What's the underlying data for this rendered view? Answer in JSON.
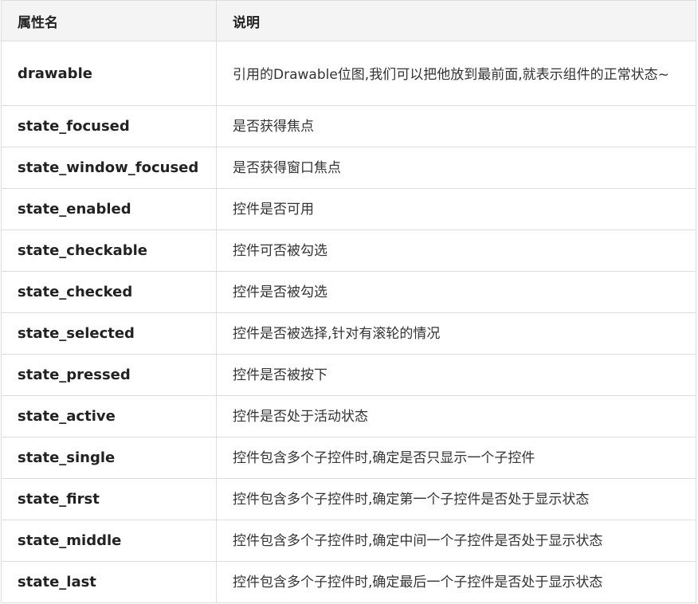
{
  "header": {
    "name": "属性名",
    "description": "说明"
  },
  "rows": [
    {
      "name": "drawable",
      "description": "引用的Drawable位图,我们可以把他放到最前面,就表示组件的正常状态~"
    },
    {
      "name": "state_focused",
      "description": "是否获得焦点"
    },
    {
      "name": "state_window_focused",
      "description": "是否获得窗口焦点"
    },
    {
      "name": "state_enabled",
      "description": "控件是否可用"
    },
    {
      "name": "state_checkable",
      "description": "控件可否被勾选"
    },
    {
      "name": "state_checked",
      "description": "控件是否被勾选"
    },
    {
      "name": "state_selected",
      "description": "控件是否被选择,针对有滚轮的情况"
    },
    {
      "name": "state_pressed",
      "description": "控件是否被按下"
    },
    {
      "name": "state_active",
      "description": "控件是否处于活动状态"
    },
    {
      "name": "state_single",
      "description": "控件包含多个子控件时,确定是否只显示一个子控件"
    },
    {
      "name": "state_first",
      "description": "控件包含多个子控件时,确定第一个子控件是否处于显示状态"
    },
    {
      "name": "state_middle",
      "description": "控件包含多个子控件时,确定中间一个子控件是否处于显示状态"
    },
    {
      "name": "state_last",
      "description": "控件包含多个子控件时,确定最后一个子控件是否处于显示状态"
    }
  ]
}
